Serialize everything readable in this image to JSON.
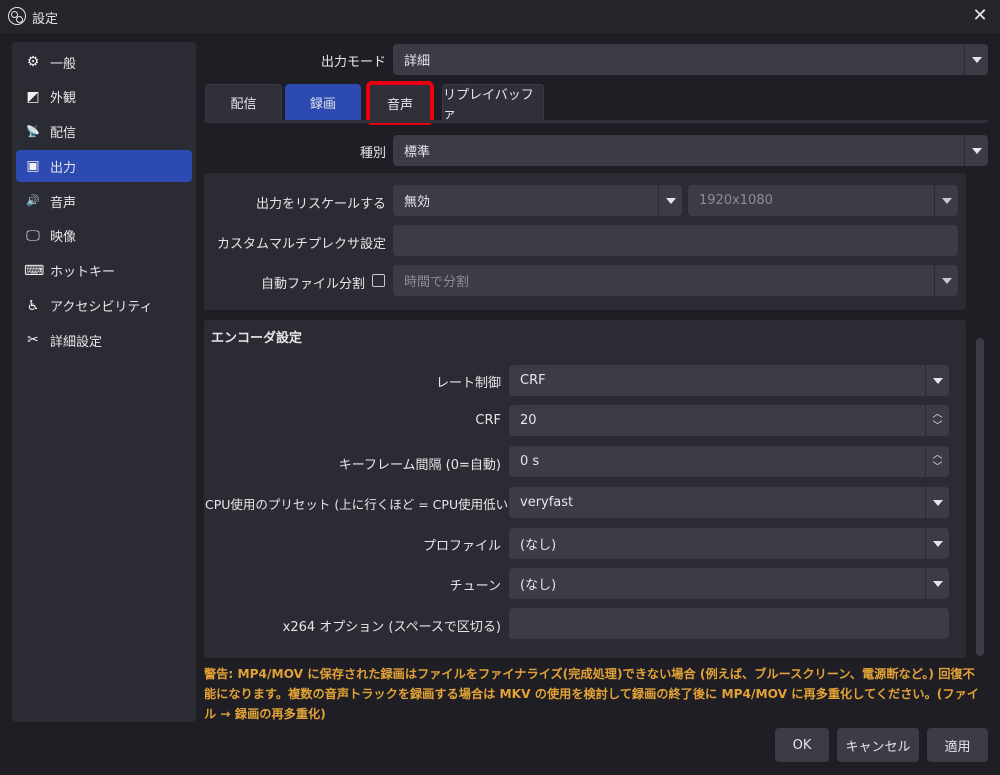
{
  "window": {
    "title": "設定"
  },
  "sidebar": {
    "items": [
      {
        "label": "一般",
        "icon": "gear-icon",
        "glyph": "⚙"
      },
      {
        "label": "外観",
        "icon": "appearance-icon",
        "glyph": "◩"
      },
      {
        "label": "配信",
        "icon": "broadcast-icon",
        "glyph": "📡"
      },
      {
        "label": "出力",
        "icon": "output-icon",
        "glyph": "▣"
      },
      {
        "label": "音声",
        "icon": "speaker-icon",
        "glyph": "🔊"
      },
      {
        "label": "映像",
        "icon": "monitor-icon",
        "glyph": "🖵"
      },
      {
        "label": "ホットキー",
        "icon": "keyboard-icon",
        "glyph": "⌨"
      },
      {
        "label": "アクセシビリティ",
        "icon": "accessibility-icon",
        "glyph": "♿"
      },
      {
        "label": "詳細設定",
        "icon": "tools-icon",
        "glyph": "✂"
      }
    ],
    "active_index": 3
  },
  "output_mode": {
    "label": "出力モード",
    "value": "詳細"
  },
  "tabs": [
    {
      "label": "配信"
    },
    {
      "label": "録画"
    },
    {
      "label": "音声"
    },
    {
      "label": "リプレイバッファ"
    }
  ],
  "type": {
    "label": "種別",
    "value": "標準"
  },
  "rescale": {
    "label": "出力をリスケールする",
    "value": "無効",
    "resolution": "1920x1080"
  },
  "mux": {
    "label": "カスタムマルチプレクサ設定",
    "value": ""
  },
  "split": {
    "label": "自動ファイル分割",
    "value": "時間で分割"
  },
  "encoder": {
    "heading": "エンコーダ設定",
    "rate_control": {
      "label": "レート制御",
      "value": "CRF"
    },
    "crf": {
      "label": "CRF",
      "value": "20"
    },
    "keyframe": {
      "label": "キーフレーム間隔 (0=自動)",
      "value": "0 s"
    },
    "preset": {
      "label": "CPU使用のプリセット (上に行くほど = CPU使用低い)",
      "value": "veryfast"
    },
    "profile": {
      "label": "プロファイル",
      "value": "(なし)"
    },
    "tune": {
      "label": "チューン",
      "value": "(なし)"
    },
    "x264opts": {
      "label": "x264 オプション (スペースで区切る)",
      "value": ""
    }
  },
  "warning": "警告: MP4/MOV に保存された録画はファイルをファイナライズ(完成処理)できない場合 (例えば、ブルースクリーン、電源断など。) 回復不能になります。複数の音声トラックを録画する場合は MKV の使用を検討して録画の終了後に MP4/MOV に再多重化してください。(ファイル → 録画の再多重化)",
  "buttons": {
    "ok": "OK",
    "cancel": "キャンセル",
    "apply": "適用"
  },
  "colors": {
    "accent": "#2c4ab0",
    "highlight": "#e60012",
    "warning": "#e3a236"
  }
}
